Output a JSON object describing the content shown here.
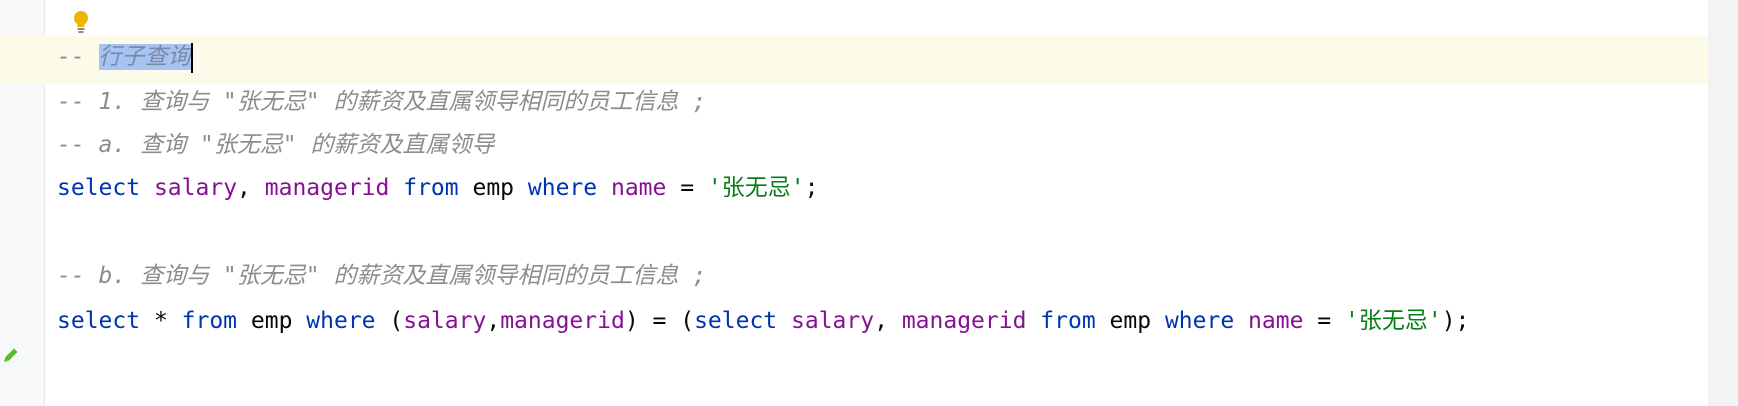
{
  "editor": {
    "lines": {
      "l1": {
        "dash": "-- ",
        "selected_text": "行子查询"
      },
      "l2": "-- 1. 查询与 \"张无忌\" 的薪资及直属领导相同的员工信息 ;",
      "l3": "-- a. 查询 \"张无忌\" 的薪资及直属领导",
      "l4": {
        "t1": "select",
        "t2": " ",
        "t3": "salary",
        "t4": ", ",
        "t5": "managerid",
        "t6": " ",
        "t7": "from",
        "t8": " emp ",
        "t9": "where",
        "t10": " ",
        "t11": "name",
        "t12": " = ",
        "t13": "'张无忌'",
        "t14": ";"
      },
      "l5": "-- b. 查询与 \"张无忌\" 的薪资及直属领导相同的员工信息 ;",
      "l6": {
        "t1": "select",
        "t2": " * ",
        "t3": "from",
        "t4": " emp ",
        "t5": "where",
        "t6": " (",
        "t7": "salary",
        "t8": ",",
        "t9": "managerid",
        "t10": ") = (",
        "t11": "select",
        "t12": " ",
        "t13": "salary",
        "t14": ", ",
        "t15": "managerid",
        "t16": " ",
        "t17": "from",
        "t18": " emp ",
        "t19": "where",
        "t20": " ",
        "t21": "name",
        "t22": " = ",
        "t23": "'张无忌'",
        "t24": ");"
      }
    },
    "icons": {
      "intention": "lightbulb-icon",
      "gutter_marker": "edit-pencil-icon"
    },
    "colors": {
      "keyword": "#0033b3",
      "field": "#871094",
      "string": "#067d17",
      "comment": "#8c8c8c",
      "selection": "#a6c4f2",
      "current_line": "#fcfae8",
      "bulb": "#f0b400"
    }
  }
}
